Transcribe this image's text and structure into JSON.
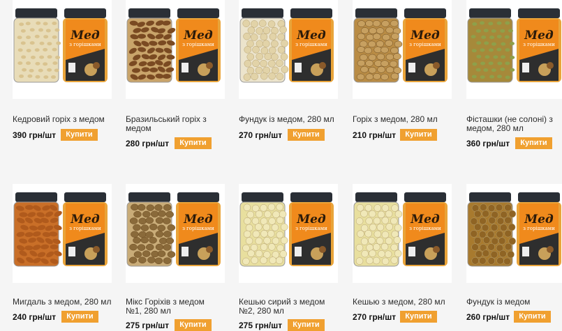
{
  "colors": {
    "page_bg": "#f5f5f5",
    "card_bg": "#ffffff",
    "buy_button": "#f0a030",
    "label_orange": "#f08a1c",
    "lid": "#2a2f36"
  },
  "products": [
    {
      "name": "Кедровий горіх з медом",
      "price": "390 грн/шт",
      "buy": "Купити",
      "filling": "pine-nuts",
      "label_title": "Мед",
      "label_sub": "з горішками"
    },
    {
      "name": "Бразильський горіх з медом",
      "price": "280 грн/шт",
      "buy": "Купити",
      "filling": "brazil-nuts",
      "label_title": "Мед",
      "label_sub": "з горішками"
    },
    {
      "name": "Фундук із медом, 280 мл",
      "price": "270 грн/шт",
      "buy": "Купити",
      "filling": "hazelnuts",
      "label_title": "Мед",
      "label_sub": "з горішками"
    },
    {
      "name": "Горіх з медом, 280 мл",
      "price": "210 грн/шт",
      "buy": "Купити",
      "filling": "walnuts",
      "label_title": "Мед",
      "label_sub": "з горішками"
    },
    {
      "name": "Фісташки (не солоні) з медом, 280 мл",
      "price": "360 грн/шт",
      "buy": "Купити",
      "filling": "pistachios",
      "label_title": "Мед",
      "label_sub": "з горішками"
    },
    {
      "name": "Мигдаль з медом, 280 мл",
      "price": "240 грн/шт",
      "buy": "Купити",
      "filling": "almonds",
      "label_title": "Мед",
      "label_sub": "з горішками"
    },
    {
      "name": "Мікс Горіхів з медом №1, 280 мл",
      "price": "275 грн/шт",
      "buy": "Купити",
      "filling": "nut-mix",
      "label_title": "Мед",
      "label_sub": "з горішками"
    },
    {
      "name": "Кешью сирий з медом №2, 280 мл",
      "price": "275 грн/шт",
      "buy": "Купити",
      "filling": "cashews",
      "label_title": "Мед",
      "label_sub": "з горішками"
    },
    {
      "name": "Кешью з медом, 280 мл",
      "price": "270 грн/шт",
      "buy": "Купити",
      "filling": "cashews",
      "label_title": "Мед",
      "label_sub": "з горішками"
    },
    {
      "name": "Фундук із медом",
      "price": "260 грн/шт",
      "buy": "Купити",
      "filling": "hazelnuts-roasted",
      "label_title": "Мед",
      "label_sub": "з горішками"
    }
  ]
}
